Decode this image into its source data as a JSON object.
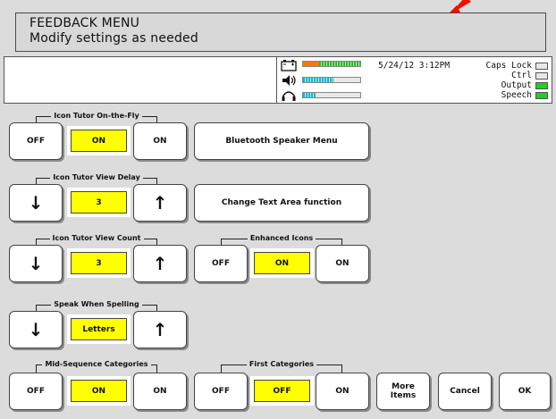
{
  "header": {
    "title": "FEEDBACK MENU",
    "subtitle": "Modify settings as needed"
  },
  "status": {
    "datetime": "5/24/12  3:12PM",
    "caps_lock": "Caps Lock",
    "ctrl": "Ctrl",
    "output": "Output",
    "speech": "Speech"
  },
  "groups": {
    "icon_tutor_on_the_fly": {
      "label": "Icon Tutor On-the-Fly",
      "off": "OFF",
      "value": "ON",
      "on": "ON"
    },
    "icon_tutor_view_delay": {
      "label": "Icon Tutor View Delay",
      "value": "3"
    },
    "icon_tutor_view_count": {
      "label": "Icon Tutor View Count",
      "value": "3"
    },
    "speak_when_spelling": {
      "label": "Speak When Spelling",
      "value": "Letters"
    },
    "mid_sequence_categories": {
      "label": "Mid-Sequence Categories",
      "off": "OFF",
      "value": "ON",
      "on": "ON"
    },
    "enhanced_icons": {
      "label": "Enhanced Icons",
      "off": "OFF",
      "value": "ON",
      "on": "ON"
    },
    "first_categories": {
      "label": "First Categories",
      "off": "OFF",
      "value": "OFF",
      "on": "ON"
    }
  },
  "buttons": {
    "bluetooth": "Bluetooth Speaker Menu",
    "change_text_area": "Change Text Area function",
    "more_items_1": "More",
    "more_items_2": "Items",
    "cancel": "Cancel",
    "ok": "OK",
    "down_arrow": "↓",
    "up_arrow": "↑"
  },
  "icons": [
    "battery-icon",
    "speaker-icon",
    "headphones-icon",
    "up-arrow-icon",
    "down-arrow-icon"
  ],
  "colors": {
    "selected_value": "#ffff00",
    "indicator_on": "#22cc22",
    "level_green": "#22bb22",
    "level_cyan": "#00b8d8",
    "level_orange": "#ff7700"
  }
}
